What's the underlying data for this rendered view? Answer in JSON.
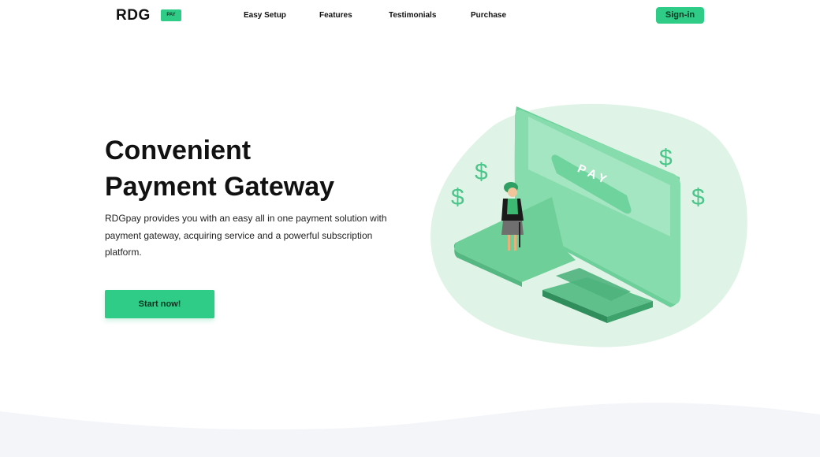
{
  "header": {
    "logo": "RDG",
    "logo_badge": "PAY",
    "nav": [
      "Easy Setup",
      "Features",
      "Testimonials",
      "Purchase"
    ],
    "signin_label": "Sign-in"
  },
  "hero": {
    "title_line1": "Convenient",
    "title_line2": "Payment Gateway",
    "description": "RDGpay provides you with an easy all in one payment solution with payment gateway, acquiring service and a powerful subscription platform.",
    "cta_label": "Start now!"
  },
  "illustration": {
    "screen_label": "PAY",
    "currency_symbol": "$"
  },
  "colors": {
    "accent": "#2ecc87",
    "blob": "#dff3e6",
    "wave": "#f3f5f8"
  }
}
